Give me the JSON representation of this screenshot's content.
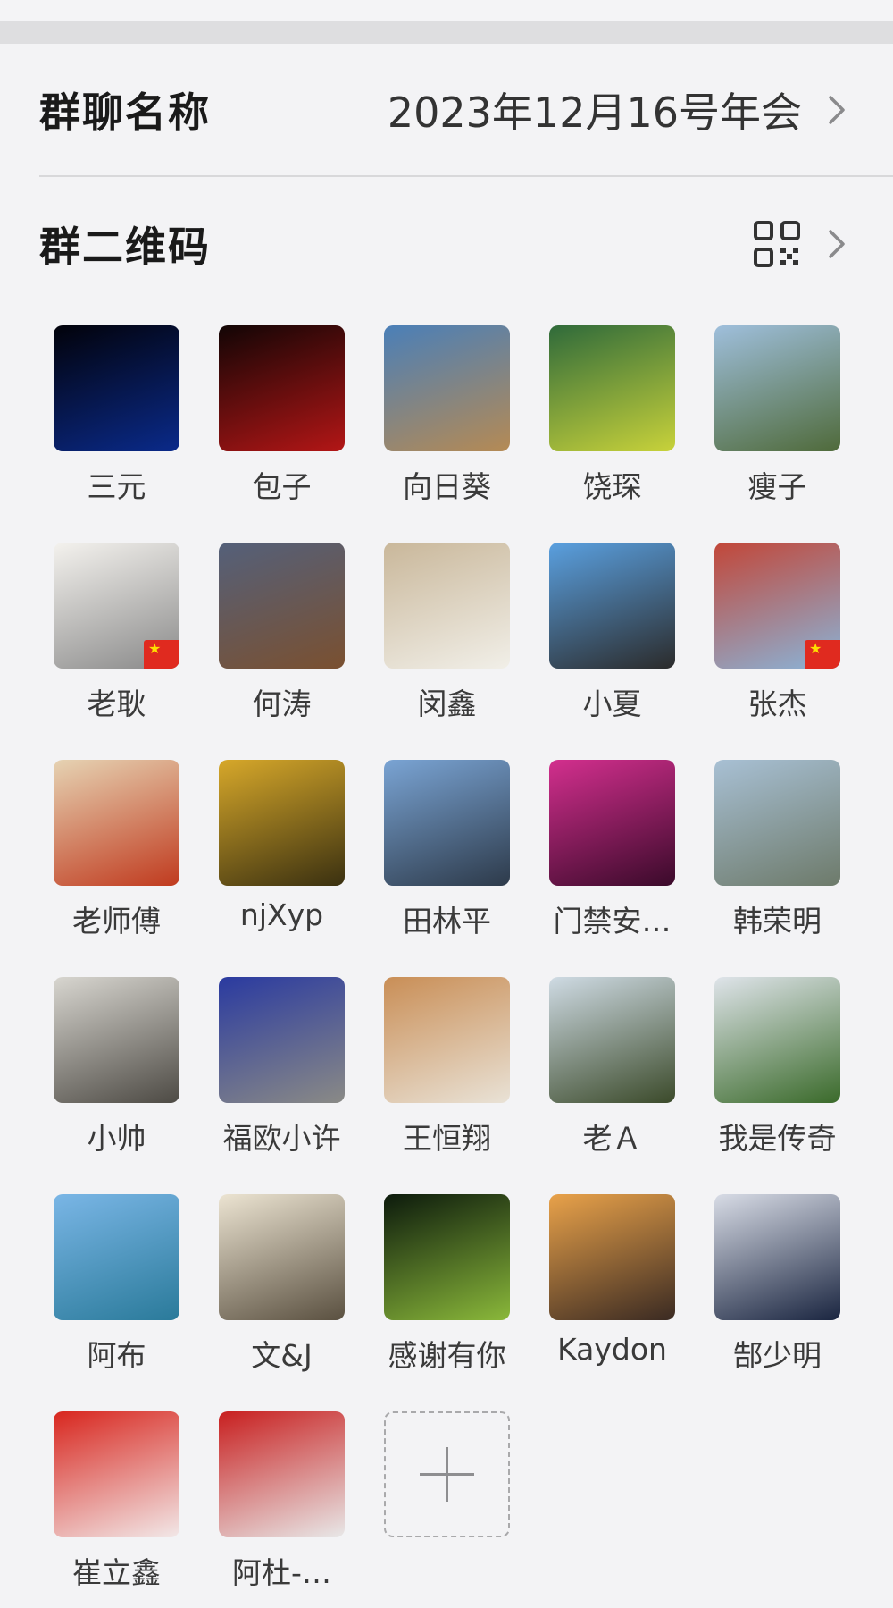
{
  "settings": {
    "group_name_label": "群聊名称",
    "group_name_value": "2023年12月16号年会",
    "qr_code_label": "群二维码",
    "qr_icon": "qr-code-icon",
    "chevron_icon": "chevron-right-icon"
  },
  "members": [
    {
      "name": "三元",
      "flag": false,
      "colors": [
        "#02020a",
        "#0a2a8a"
      ]
    },
    {
      "name": "包子",
      "flag": false,
      "colors": [
        "#120505",
        "#b31616"
      ]
    },
    {
      "name": "向日葵",
      "flag": false,
      "colors": [
        "#4a7fb8",
        "#b58a54"
      ]
    },
    {
      "name": "饶琛",
      "flag": false,
      "colors": [
        "#2f6a3a",
        "#c8d23a"
      ]
    },
    {
      "name": "瘦子",
      "flag": false,
      "colors": [
        "#9fbfdc",
        "#4f6a3a"
      ]
    },
    {
      "name": "老耿",
      "flag": true,
      "colors": [
        "#f4f2ee",
        "#8a8a8a"
      ]
    },
    {
      "name": "何涛",
      "flag": false,
      "colors": [
        "#54607a",
        "#7a5030"
      ]
    },
    {
      "name": "闵鑫",
      "flag": false,
      "colors": [
        "#c9b79a",
        "#f1efe8"
      ]
    },
    {
      "name": "小夏",
      "flag": false,
      "colors": [
        "#5aa0e0",
        "#2b2b2b"
      ]
    },
    {
      "name": "张杰",
      "flag": true,
      "colors": [
        "#c24638",
        "#8ab4d8"
      ]
    },
    {
      "name": "老师傅",
      "flag": false,
      "colors": [
        "#e6d3b3",
        "#c03a1e"
      ]
    },
    {
      "name": "njXyp",
      "flag": false,
      "colors": [
        "#d7a82a",
        "#3a3010"
      ]
    },
    {
      "name": "田林平",
      "flag": false,
      "colors": [
        "#7aa4d4",
        "#2d3a4a"
      ]
    },
    {
      "name": "门禁安…",
      "flag": false,
      "colors": [
        "#d32f8e",
        "#3a0a2a"
      ]
    },
    {
      "name": "韩荣明",
      "flag": false,
      "colors": [
        "#a8c0d4",
        "#6d7a6a"
      ]
    },
    {
      "name": "小帅",
      "flag": false,
      "colors": [
        "#d8d6d0",
        "#4d4a44"
      ]
    },
    {
      "name": "福欧小许",
      "flag": false,
      "colors": [
        "#2a3aa0",
        "#8a8a86"
      ]
    },
    {
      "name": "王恒翔",
      "flag": false,
      "colors": [
        "#c98e56",
        "#e9e2d6"
      ]
    },
    {
      "name": "老Ａ",
      "flag": false,
      "colors": [
        "#cfdbe4",
        "#3b4a2a"
      ]
    },
    {
      "name": "我是传奇",
      "flag": false,
      "colors": [
        "#dfe4ea",
        "#3a6a2a"
      ]
    },
    {
      "name": "阿布",
      "flag": false,
      "colors": [
        "#7ab6e6",
        "#2a7a9a"
      ]
    },
    {
      "name": "文&J",
      "flag": false,
      "colors": [
        "#ece4d2",
        "#5a5040"
      ]
    },
    {
      "name": "感谢有你",
      "flag": false,
      "colors": [
        "#0c1a0c",
        "#8ab83a"
      ]
    },
    {
      "name": "Kaydon",
      "flag": false,
      "colors": [
        "#e9a24a",
        "#3a2a22"
      ]
    },
    {
      "name": "郜少明",
      "flag": false,
      "colors": [
        "#d8dce6",
        "#1a2540"
      ]
    },
    {
      "name": "崔立鑫",
      "flag": false,
      "colors": [
        "#d8261e",
        "#f2e8e8"
      ]
    },
    {
      "name": "阿杜-…",
      "flag": false,
      "colors": [
        "#c81f1f",
        "#e8e8e8"
      ]
    }
  ],
  "add_member_icon": "plus-icon"
}
